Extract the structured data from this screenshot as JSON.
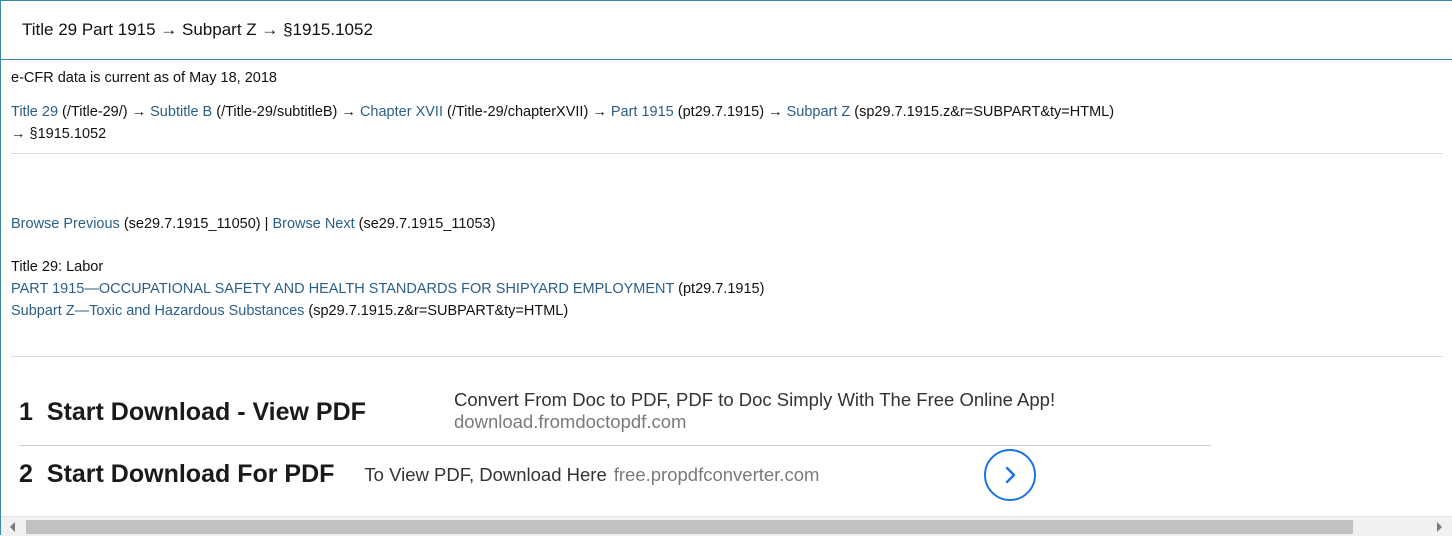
{
  "heading": "Title 29 Part 1915 → Subpart Z → §1915.1052",
  "current_as_of": "e-CFR data is current as of May 18, 2018",
  "breadcrumb": [
    {
      "link": "Title 29",
      "path": " (/Title-29/) → "
    },
    {
      "link": "Subtitle B",
      "path": " (/Title-29/subtitleB) → "
    },
    {
      "link": "Chapter XVII",
      "path": " (/Title-29/chapterXVII) → "
    },
    {
      "link": "Part 1915",
      "path": " (pt29.7.1915) → "
    },
    {
      "link": "Subpart Z",
      "path": " (sp29.7.1915.z&r=SUBPART&ty=HTML)"
    }
  ],
  "breadcrumb_tail": "→ §1915.1052",
  "browse": {
    "prev_link": "Browse Previous",
    "prev_ref": " (se29.7.1915_11050) | ",
    "next_link": "Browse Next",
    "next_ref": " (se29.7.1915_11053)"
  },
  "title_line": "Title 29: Labor",
  "part": {
    "link": "PART 1915—OCCUPATIONAL SAFETY AND HEALTH STANDARDS FOR SHIPYARD EMPLOYMENT",
    "ref": " (pt29.7.1915)"
  },
  "subpart": {
    "link": "Subpart Z—Toxic and Hazardous Substances",
    "ref": " (sp29.7.1915.z&r=SUBPART&ty=HTML)"
  },
  "ads": [
    {
      "num": "1",
      "title": "Start Download - View PDF",
      "desc": "Convert From Doc to PDF, PDF to Doc Simply With The Free Online App!",
      "url": "download.fromdoctopdf.com"
    },
    {
      "num": "2",
      "title": "Start Download For PDF",
      "desc": "To View PDF, Download Here",
      "url": "free.propdfconverter.com"
    }
  ],
  "colors": {
    "link": "#2a5f8a",
    "panel_border": "#3a87ad",
    "ad_arrow": "#1a73e8"
  },
  "icons": {
    "ad_arrow": "chevron-right-icon",
    "scroll_left": "scroll-left-arrow",
    "scroll_right": "scroll-right-arrow"
  }
}
